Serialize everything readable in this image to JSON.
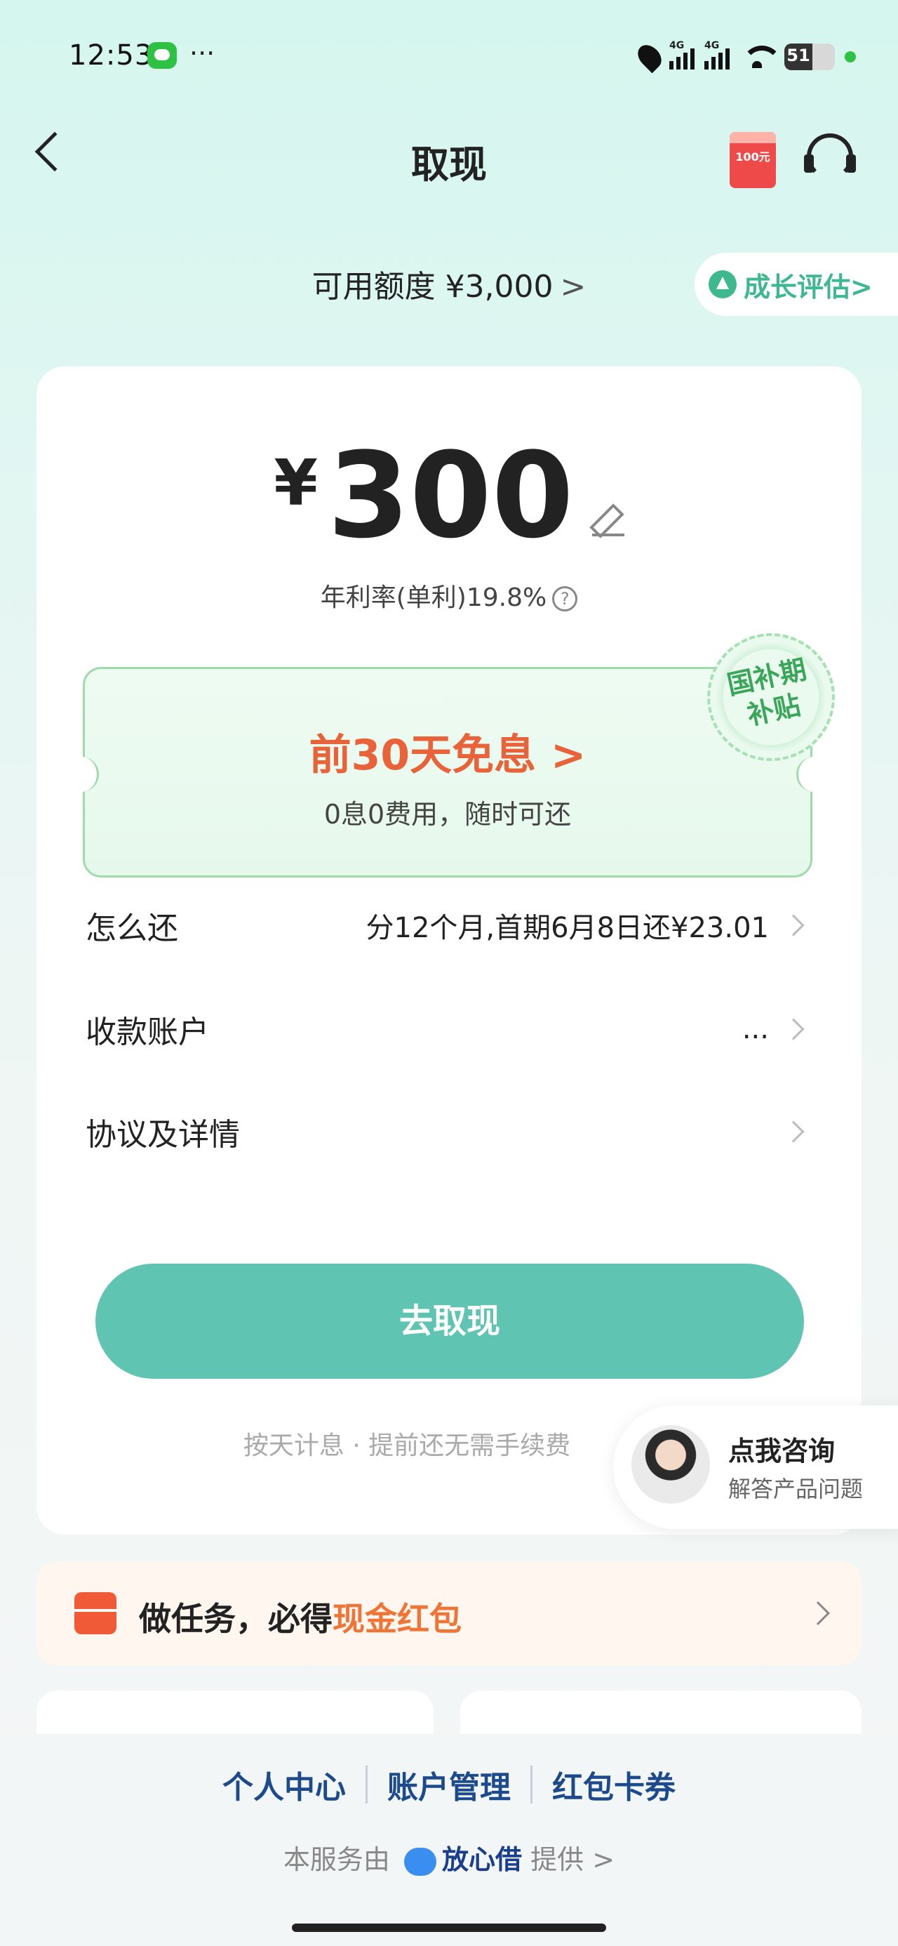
{
  "status_bar": {
    "time": "12:53",
    "more": "···",
    "battery": "51",
    "network_tag_1": "4G",
    "network_tag_2": "4G"
  },
  "nav": {
    "title": "取现",
    "redpacket_label": "100元"
  },
  "credit": {
    "text": "可用额度 ¥3,000",
    "chevron": ">",
    "growth_label": "成长评估>"
  },
  "amount": {
    "currency": "¥",
    "value": "300",
    "rate_text": "年利率(单利)19.8%",
    "help": "?"
  },
  "promo": {
    "title": "前30天免息 >",
    "subtitle": "0息0费用，随时可还",
    "stamp_line1": "国补期",
    "stamp_line2": "补贴"
  },
  "rows": [
    {
      "label": "怎么还",
      "value": "分12个月,首期6月8日还¥23.01"
    },
    {
      "label": "收款账户",
      "value": "..."
    },
    {
      "label": "协议及详情",
      "value": ""
    }
  ],
  "cta": {
    "label": "去取现"
  },
  "hint": "按天计息 · 提前还无需手续费",
  "consult": {
    "title": "点我咨询",
    "subtitle": "解答产品问题"
  },
  "task": {
    "prefix": "做任务，必得",
    "highlight": "现金红包"
  },
  "footer": {
    "links": [
      "个人中心",
      "账户管理",
      "红包卡券"
    ],
    "provider_prefix": "本服务由",
    "provider_brand": "放心借",
    "provider_suffix": "提供 >"
  },
  "colors": {
    "accent": "#5fc4b1",
    "promo_orange": "#e8633a",
    "link_blue": "#1c4a8c"
  }
}
